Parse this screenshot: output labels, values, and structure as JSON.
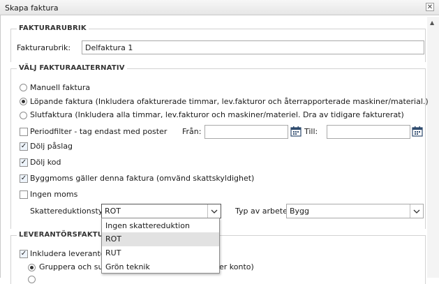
{
  "window": {
    "title": "Skapa faktura",
    "close_icon": "close-icon"
  },
  "sections": {
    "fakturarubrik": "FAKTURARUBRIK",
    "valj": "VÄLJ FAKTURAALTERNATIV",
    "leverantor": "LEVERANTÖRSFAKTUR"
  },
  "fakturarubrik": {
    "label": "Fakturarubrik:",
    "value": "Delfaktura 1"
  },
  "options": {
    "manuell": "Manuell faktura",
    "lopande": "Löpande faktura (Inkludera ofakturerade timmar, lev.fakturor och återrapporterade maskiner/material.)",
    "slut": "Slutfaktura (Inkludera alla timmar, lev.fakturor och maskiner/materiel. Dra av tidigare fakturerat)",
    "selected": "lopande"
  },
  "periodfilter": {
    "label": "Periodfilter - tag endast med poster",
    "from_label": "Från:",
    "to_label": "Till:",
    "from_value": "",
    "to_value": ""
  },
  "checkboxes": {
    "dolj_paslag": "Dölj påslag",
    "dolj_kod": "Dölj kod",
    "byggmoms": "Byggmoms gäller denna faktura (omvänd skattskyldighet)",
    "ingen_moms": "Ingen moms"
  },
  "skatte": {
    "label": "Skattereduktionstyp:",
    "value": "ROT",
    "options": [
      "Ingen skattereduktion",
      "ROT",
      "RUT",
      "Grön teknik"
    ],
    "highlighted": "ROT"
  },
  "typ": {
    "label": "Typ av arbete:",
    "value": "Bygg"
  },
  "leverantor": {
    "include_label": "Inkludera leverantörs",
    "group_label": "Gruppera och sum",
    "group_tail": "er konto)"
  }
}
